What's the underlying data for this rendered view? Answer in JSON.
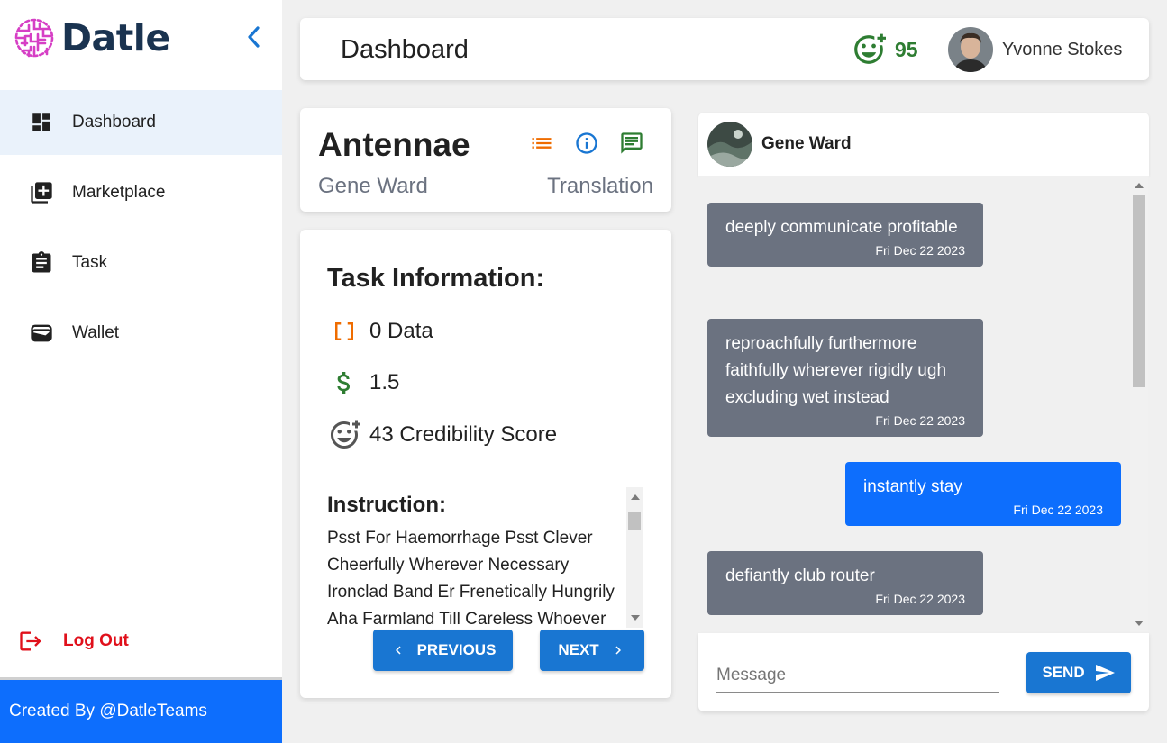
{
  "brand": {
    "name": "Datle",
    "logo_icon": "brain-maze-icon",
    "logo_color": "#d63fc5"
  },
  "sidebar": {
    "collapse_icon": "chevron-left-icon",
    "items": [
      {
        "label": "Dashboard",
        "icon": "dashboard-icon",
        "active": true
      },
      {
        "label": "Marketplace",
        "icon": "library-add-icon",
        "active": false
      },
      {
        "label": "Task",
        "icon": "clipboard-icon",
        "active": false
      },
      {
        "label": "Wallet",
        "icon": "wallet-icon",
        "active": false
      }
    ],
    "logout_label": "Log Out",
    "footer_text": "Created By @DatleTeams"
  },
  "header": {
    "title": "Dashboard",
    "score": "95",
    "user_name": "Yvonne Stokes"
  },
  "project": {
    "title": "Antennae",
    "owner": "Gene Ward",
    "type": "Translation"
  },
  "task": {
    "heading": "Task Information:",
    "data_label": "0 Data",
    "price_label": "1.5",
    "credibility_label": "43 Credibility Score",
    "instruction_heading": "Instruction:",
    "instruction_text": "Psst For Haemorrhage Psst Clever Cheerfully Wherever Necessary Ironclad Band Er Frenetically Hungrily Aha Farmland Till Careless Whoever",
    "prev_label": "PREVIOUS",
    "next_label": "NEXT"
  },
  "chat": {
    "contact_name": "Gene Ward",
    "messages": [
      {
        "text": "deeply communicate profitable",
        "date": "Fri Dec 22 2023",
        "direction": "in"
      },
      {
        "text": "reproachfully furthermore faithfully wherever rigidly ugh excluding wet instead",
        "date": "Fri Dec 22 2023",
        "direction": "in"
      },
      {
        "text": "instantly stay",
        "date": "Fri Dec 22 2023",
        "direction": "out"
      },
      {
        "text": "defiantly club router",
        "date": "Fri Dec 22 2023",
        "direction": "in"
      }
    ],
    "input_placeholder": "Message",
    "send_label": "SEND"
  },
  "colors": {
    "primary": "#1976d2",
    "bubble_out": "#0d6efd",
    "bubble_in": "#6b7280",
    "logout": "#e0101b",
    "score": "#2e7d32",
    "orange": "#ef6c00"
  }
}
